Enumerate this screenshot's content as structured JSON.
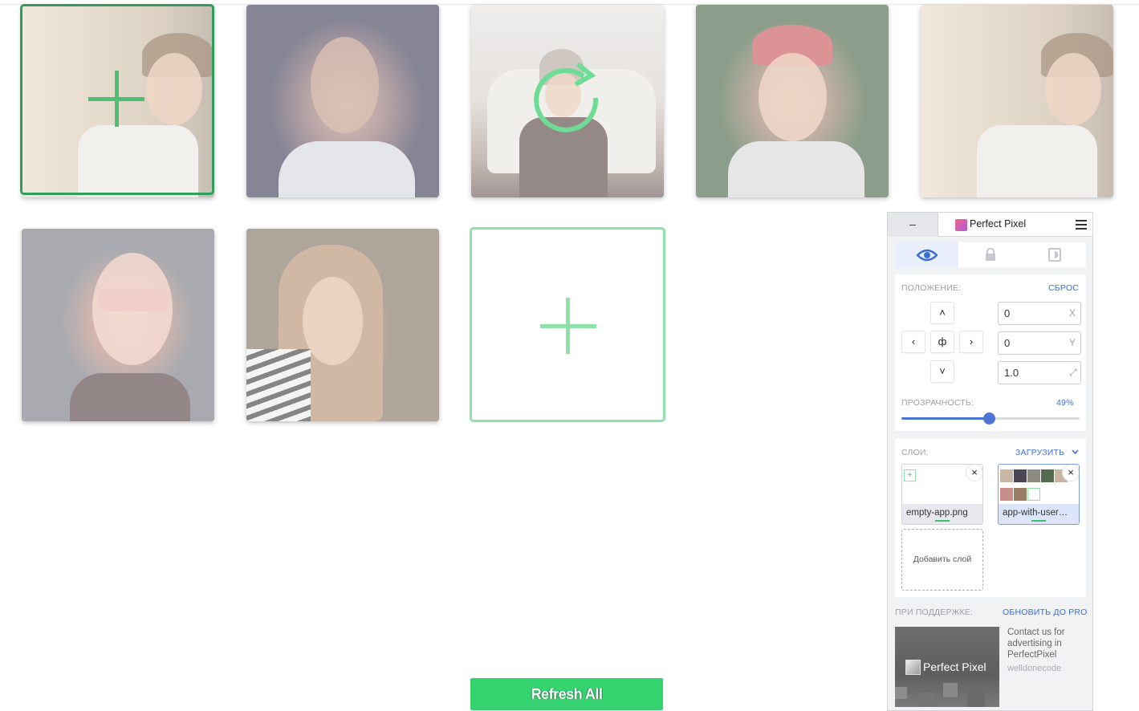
{
  "app": {
    "add_tile_action": "add-photo",
    "refresh_button": "Refresh All"
  },
  "perfect_pixel": {
    "minimize_label": "–",
    "title": "Perfect Pixel",
    "tabs": [
      "eye-icon",
      "lock-icon",
      "invert-icon"
    ],
    "position": {
      "label": "ПОЛОЖЕНИЕ:",
      "reset": "СБРОС",
      "x_value": "0",
      "x_unit": "X",
      "y_value": "0",
      "y_unit": "Y",
      "scale_value": "1.0",
      "scale_unit": "⤢",
      "center_glyph": "ф"
    },
    "opacity": {
      "label": "ПРОЗРАЧНОСТЬ:",
      "value_text": "49%",
      "value": 0.49
    },
    "layers": {
      "label": "СЛОИ:",
      "upload": "ЗАГРУЗИТЬ",
      "items": [
        {
          "name": "empty-app.png",
          "active": false
        },
        {
          "name": "app-with-user…",
          "active": true
        }
      ],
      "add_layer": "Добавить слой"
    },
    "support": {
      "label": "ПРИ ПОДДЕРЖКЕ:",
      "upgrade": "ОБНОВИТЬ ДО PRO",
      "ad_logo": "Perfect Pixel",
      "ad_text": "Contact us for advertising in PerfectPixel",
      "ad_brand": "welldonecode"
    }
  },
  "colors": {
    "accent_green": "#35d36f",
    "selection_green": "#2f9e5b",
    "add_tile_border": "#8fe0a9",
    "panel_link": "#3c6fd4"
  }
}
